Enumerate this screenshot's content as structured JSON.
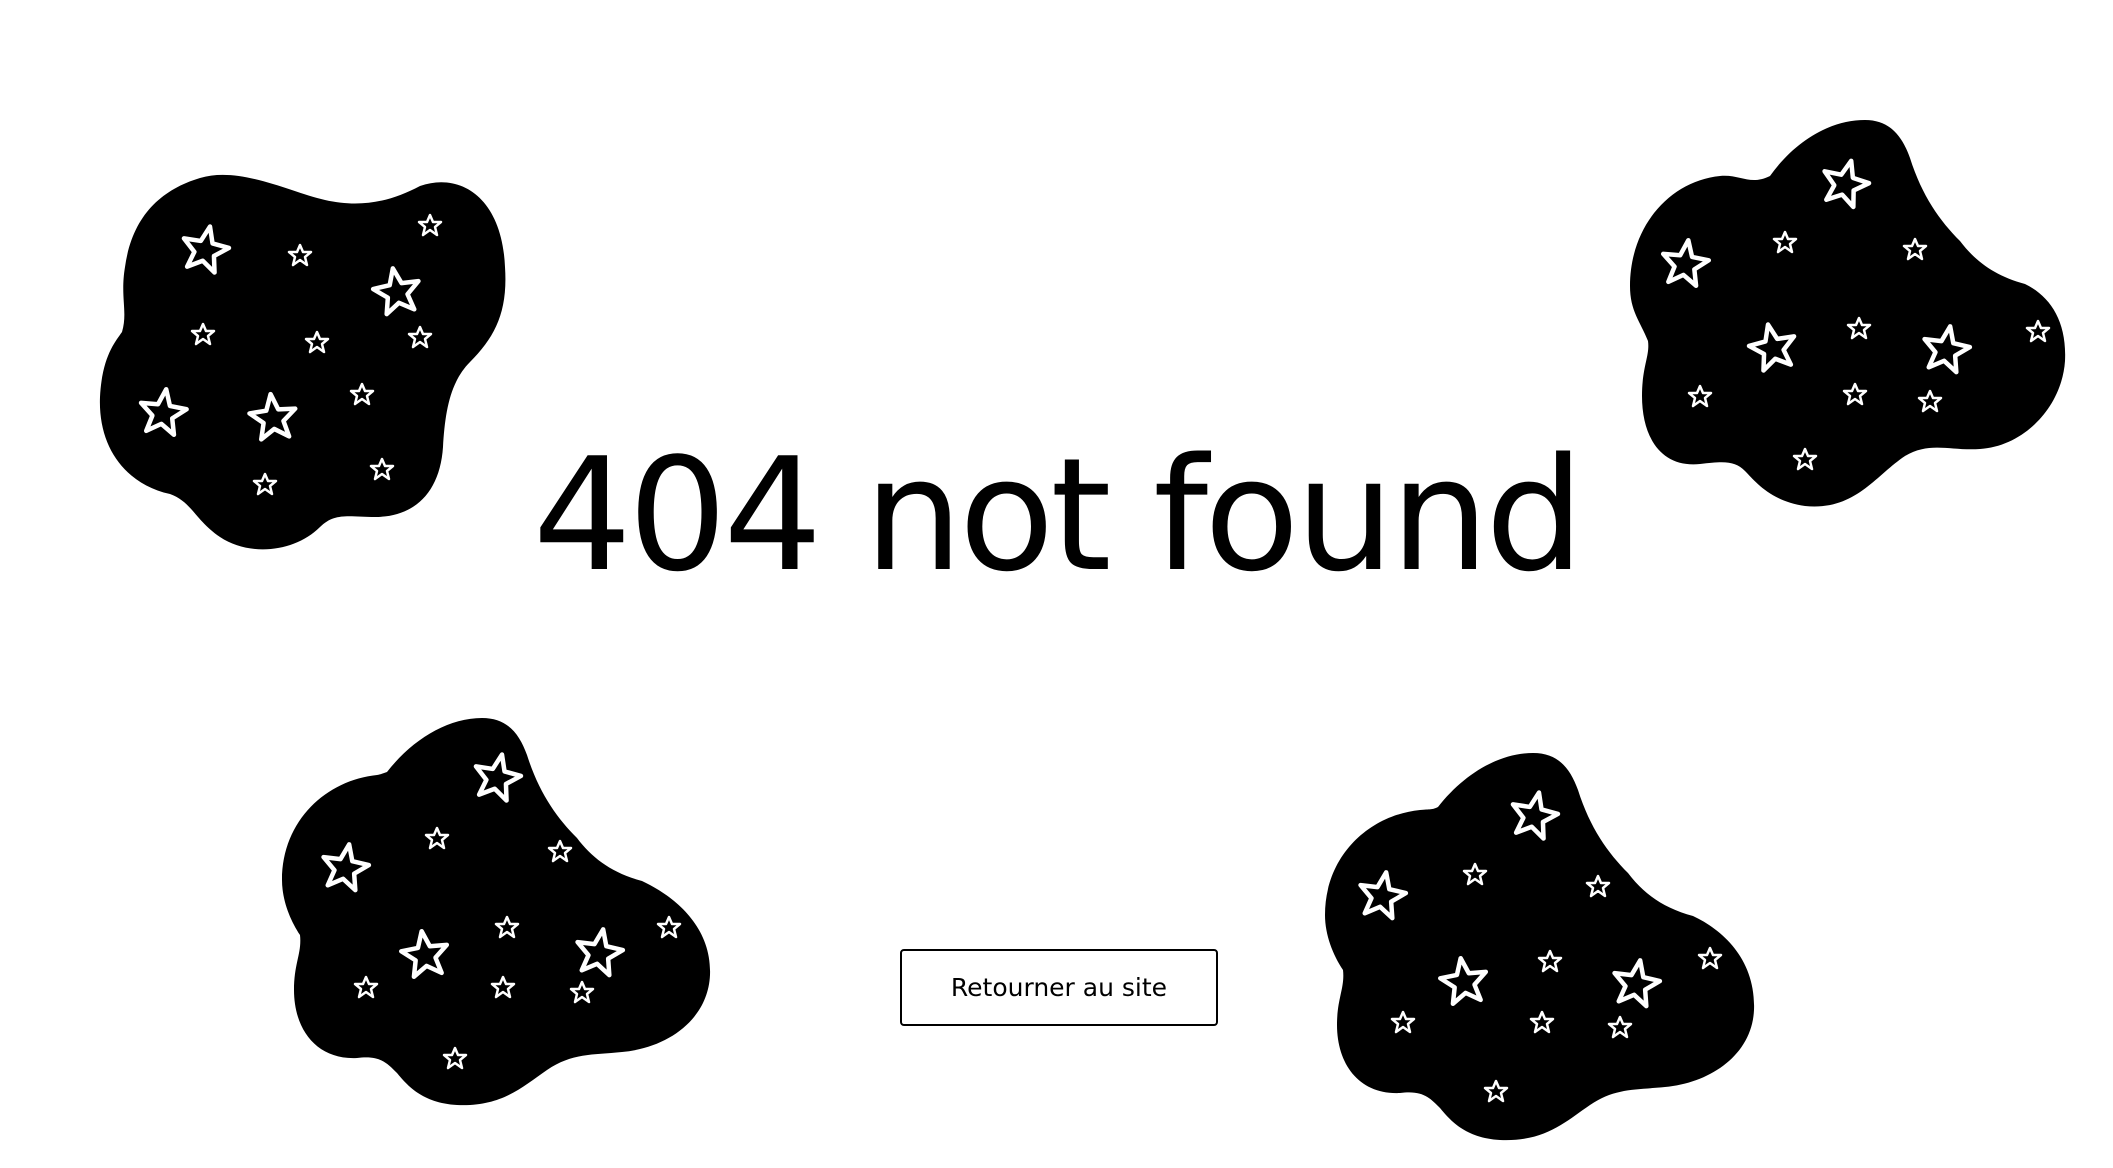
{
  "page": {
    "title": "404 not found",
    "background": "#ffffff",
    "text_color": "#000000"
  },
  "actions": {
    "back_label": "Retourner au site"
  },
  "decorations": {
    "blob_color": "#000000",
    "star_color": "#ffffff",
    "blob_icon": "star-filled-blob"
  }
}
